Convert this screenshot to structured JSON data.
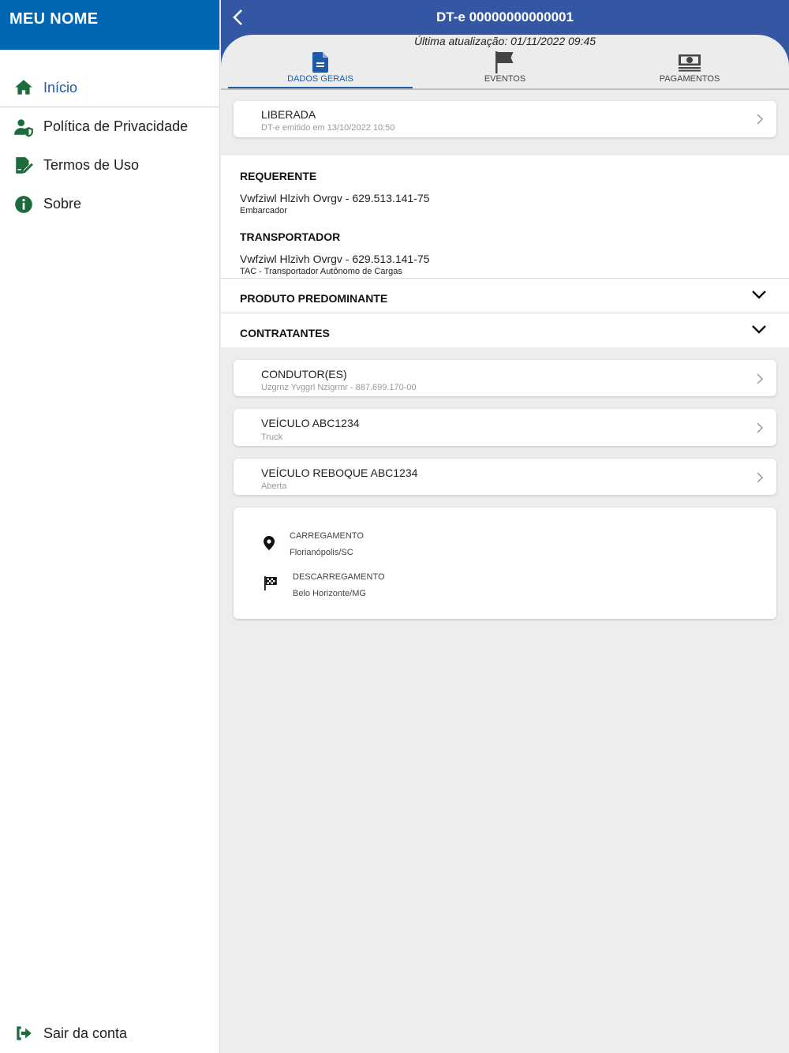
{
  "sidebar": {
    "title": "MEU NOME",
    "items": [
      {
        "label": "Início",
        "icon": "home-icon"
      },
      {
        "label": "Política de Privacidade",
        "icon": "user-shield-icon"
      },
      {
        "label": "Termos de Uso",
        "icon": "file-signature-icon"
      },
      {
        "label": "Sobre",
        "icon": "info-circle-icon"
      }
    ],
    "logout_label": "Sair da conta"
  },
  "colors": {
    "brand": "#0066b3",
    "header": "#3457a3",
    "accent": "#1f5aa6",
    "icon_green": "#1d6b3d"
  },
  "header": {
    "title": "DT-e 00000000000001",
    "updated": "Última atualização: 01/11/2022 09:45"
  },
  "tabs": [
    {
      "label": "DADOS GERAIS",
      "icon": "document-icon"
    },
    {
      "label": "EVENTOS",
      "icon": "flag-icon"
    },
    {
      "label": "PAGAMENTOS",
      "icon": "money-icon"
    }
  ],
  "status_card": {
    "title": "LIBERADA",
    "subtitle": "DT-e emitido em 13/10/2022 10:50"
  },
  "requerente": {
    "heading": "REQUERENTE",
    "name": "Vwfziwl Hlzivh Ovrgv - 629.513.141-75",
    "role": "Embarcador"
  },
  "transportador": {
    "heading": "TRANSPORTADOR",
    "name": "Vwfziwl Hlzivh Ovrgv - 629.513.141-75",
    "role": "TAC - Transportador Autônomo de Cargas"
  },
  "accordions": [
    {
      "label": "PRODUTO PREDOMINANTE"
    },
    {
      "label": "CONTRATANTES"
    }
  ],
  "cards": [
    {
      "title": "CONDUTOR(ES)",
      "subtitle": "Uzgrnz Yvggrl Nzigrmr - 887.699.170-00"
    },
    {
      "title": "VEÍCULO ABC1234",
      "subtitle": "Truck"
    },
    {
      "title": "VEÍCULO REBOQUE ABC1234",
      "subtitle": "Aberta"
    }
  ],
  "locations": {
    "loading": {
      "label": "CARREGAMENTO",
      "value": "Florianópolis/SC"
    },
    "unloading": {
      "label": "DESCARREGAMENTO",
      "value": "Belo Horizonte/MG"
    }
  }
}
